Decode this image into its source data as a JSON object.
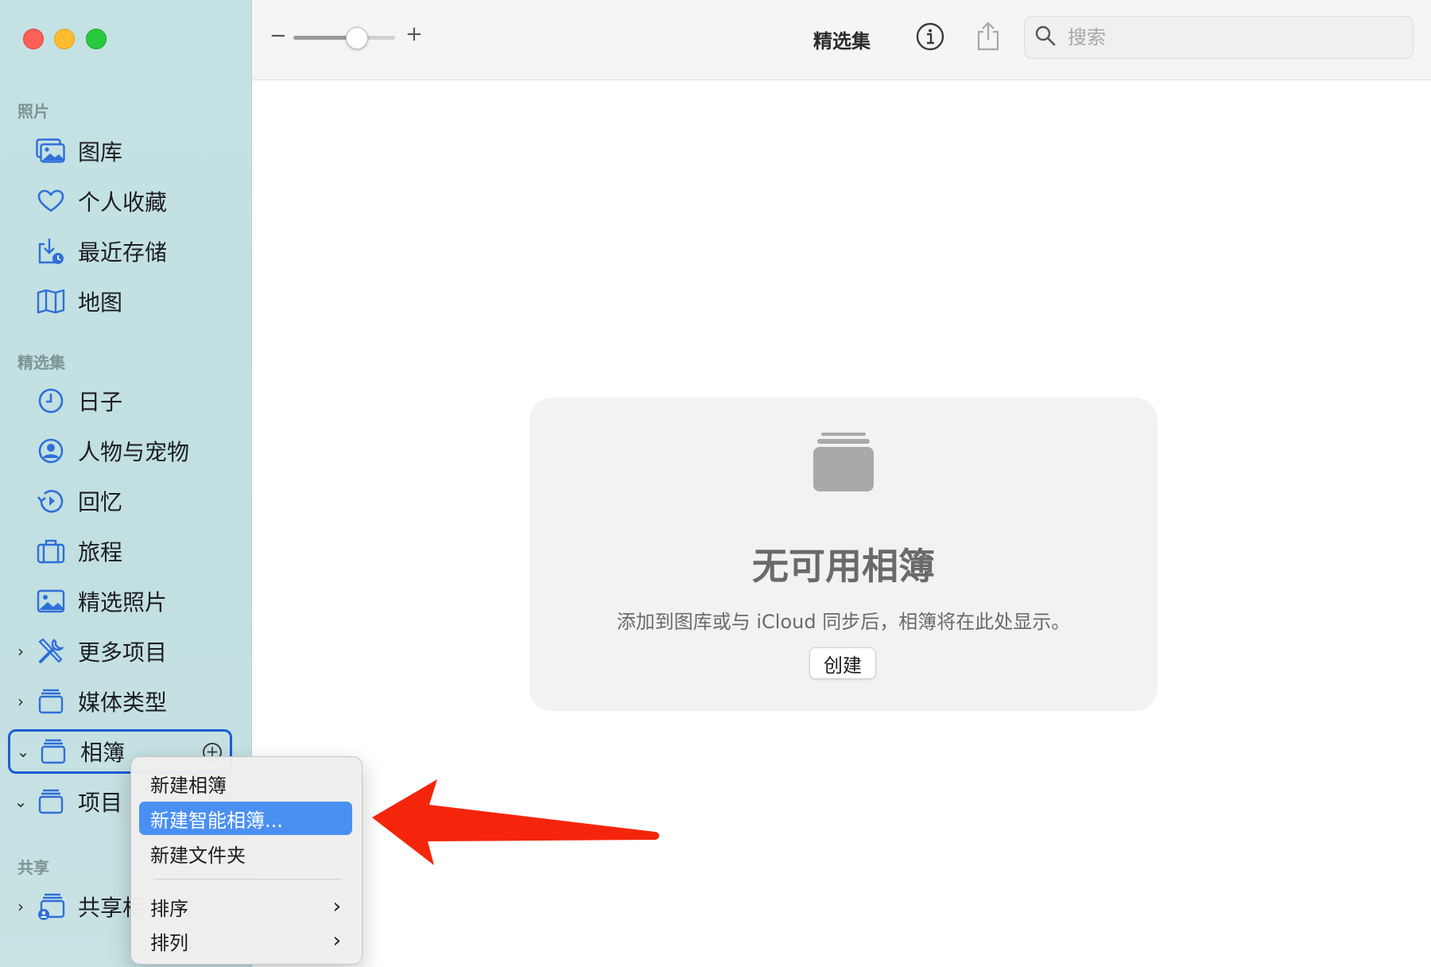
{
  "sidebar": {
    "sections": [
      {
        "label": "照片",
        "items": [
          {
            "label": "图库",
            "icon": "photo-library-icon"
          },
          {
            "label": "个人收藏",
            "icon": "heart-icon"
          },
          {
            "label": "最近存储",
            "icon": "recently-saved-icon"
          },
          {
            "label": "地图",
            "icon": "map-icon"
          }
        ]
      },
      {
        "label": "精选集",
        "items": [
          {
            "label": "日子",
            "icon": "clock-icon"
          },
          {
            "label": "人物与宠物",
            "icon": "person-circle-icon"
          },
          {
            "label": "回忆",
            "icon": "memories-icon"
          },
          {
            "label": "旅程",
            "icon": "suitcase-icon"
          },
          {
            "label": "精选照片",
            "icon": "featured-photo-icon"
          },
          {
            "label": "更多项目",
            "icon": "tools-icon"
          },
          {
            "label": "媒体类型",
            "icon": "stack-icon"
          },
          {
            "label": "相簿",
            "icon": "stack-icon"
          },
          {
            "label": "项目",
            "icon": "stack-icon"
          }
        ]
      },
      {
        "label": "共享",
        "items": [
          {
            "label": "共享相",
            "icon": "shared-album-icon"
          }
        ]
      }
    ]
  },
  "toolbar": {
    "zoom_minus": "−",
    "zoom_plus": "+",
    "zoom_level": 0.62,
    "title": "精选集",
    "search_placeholder": "搜索"
  },
  "empty_state": {
    "title": "无可用相簿",
    "description": "添加到图库或与 iCloud 同步后，相簿将在此处显示。",
    "create_button": "创建"
  },
  "context_menu": {
    "items": [
      {
        "label": "新建相簿"
      },
      {
        "label": "新建智能相簿..."
      },
      {
        "label": "新建文件夹"
      },
      {
        "label": "排序"
      },
      {
        "label": "排列"
      }
    ]
  },
  "colors": {
    "accent": "#1d5bd6",
    "menu_highlight": "#4a90f2",
    "annotation_arrow": "#f5250c",
    "sidebar_bg": "#c4e2e4"
  }
}
